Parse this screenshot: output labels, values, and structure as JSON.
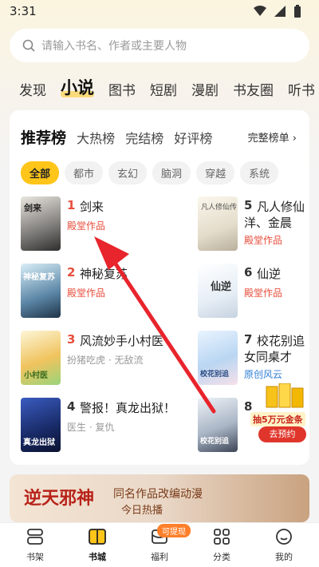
{
  "status": {
    "time": "3:31"
  },
  "search": {
    "placeholder": "请输入书名、作者或主要人物"
  },
  "nav_tabs": [
    "发现",
    "小说",
    "图书",
    "短剧",
    "漫剧",
    "书友圈",
    "听书"
  ],
  "rank": {
    "title": "推荐榜",
    "tabs": [
      "大热榜",
      "完结榜",
      "好评榜"
    ],
    "more": "完整榜单 ›",
    "filters": [
      "全部",
      "都市",
      "玄幻",
      "脑洞",
      "穿越",
      "系统"
    ]
  },
  "books": [
    {
      "rank": "1",
      "title": "剑来",
      "tag": "殿堂作品"
    },
    {
      "rank": "2",
      "title": "神秘复苏",
      "tag": "殿堂作品"
    },
    {
      "rank": "3",
      "title": "风流妙手小村医",
      "tag": "扮猪吃虎 · 无敌流"
    },
    {
      "rank": "4",
      "title": "警报！真龙出狱！",
      "tag": "医生 · 复仇"
    },
    {
      "rank": "5",
      "title": "凡人修仙",
      "title2": "洋、金晨",
      "tag": "殿堂作品"
    },
    {
      "rank": "6",
      "title": "仙逆",
      "tag": "殿堂作品"
    },
    {
      "rank": "7",
      "title": "校花别追",
      "title2": "女同桌才",
      "tag": "原创风云"
    },
    {
      "rank": "8",
      "title": "",
      "tag": ""
    }
  ],
  "covers": {
    "c1": "剑来",
    "c2": "神秘复苏",
    "c3": "小村医",
    "c4": "真龙出狱",
    "c5": "凡人修仙传",
    "c6": "仙逆",
    "c7": "校花别追",
    "c8": "校花别追"
  },
  "promo": {
    "text": "抽5万元金条",
    "button": "去预约"
  },
  "banner": {
    "logo": "逆天邪神",
    "line1": "同名作品改编动漫",
    "line2": "今日热播"
  },
  "bottom_nav": [
    "书架",
    "书城",
    "福利",
    "分类",
    "我的"
  ],
  "welfare_badge": "可提现",
  "colors": {
    "accent": "#ffc519",
    "rank_red": "#e84e3c"
  }
}
